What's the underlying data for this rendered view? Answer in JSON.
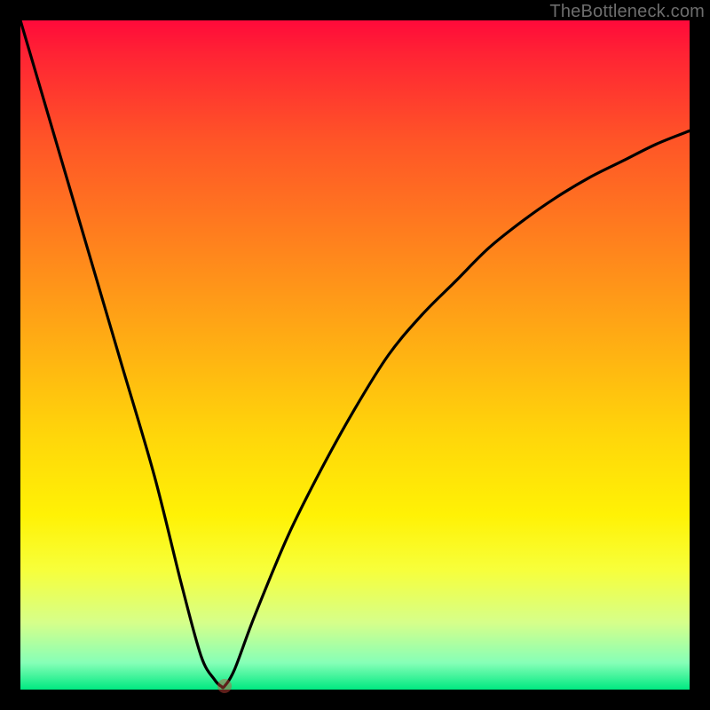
{
  "watermark": "TheBottleneck.com",
  "colors": {
    "page_bg": "#000000",
    "curve": "#000000",
    "marker": "rgba(214,70,60,0.44)"
  },
  "chart_data": {
    "type": "line",
    "title": "",
    "xlabel": "",
    "ylabel": "",
    "xlim": [
      0,
      100
    ],
    "ylim": [
      0,
      100
    ],
    "series": [
      {
        "name": "bottleneck-curve",
        "x": [
          0,
          5,
          10,
          15,
          20,
          24,
          27,
          29,
          30,
          30.5,
          32,
          35,
          40,
          45,
          50,
          55,
          60,
          65,
          70,
          75,
          80,
          85,
          90,
          95,
          100
        ],
        "values": [
          100,
          83,
          66,
          49,
          32,
          16,
          5,
          1.5,
          0.5,
          0.5,
          3,
          11,
          23,
          33,
          42,
          50,
          56,
          61,
          66,
          70,
          73.5,
          76.5,
          79,
          81.5,
          83.5
        ]
      }
    ],
    "marker": {
      "x": 30.5,
      "y": 0.5
    },
    "gradient_stops": [
      {
        "pos": 0,
        "color": "#ff0a3a"
      },
      {
        "pos": 5,
        "color": "#ff2334"
      },
      {
        "pos": 18,
        "color": "#ff5527"
      },
      {
        "pos": 32,
        "color": "#ff7e1e"
      },
      {
        "pos": 50,
        "color": "#ffb312"
      },
      {
        "pos": 62,
        "color": "#ffd60a"
      },
      {
        "pos": 74,
        "color": "#fff205"
      },
      {
        "pos": 82,
        "color": "#f7ff3a"
      },
      {
        "pos": 90,
        "color": "#d6ff8a"
      },
      {
        "pos": 96,
        "color": "#86ffb7"
      },
      {
        "pos": 100,
        "color": "#00e981"
      }
    ]
  }
}
